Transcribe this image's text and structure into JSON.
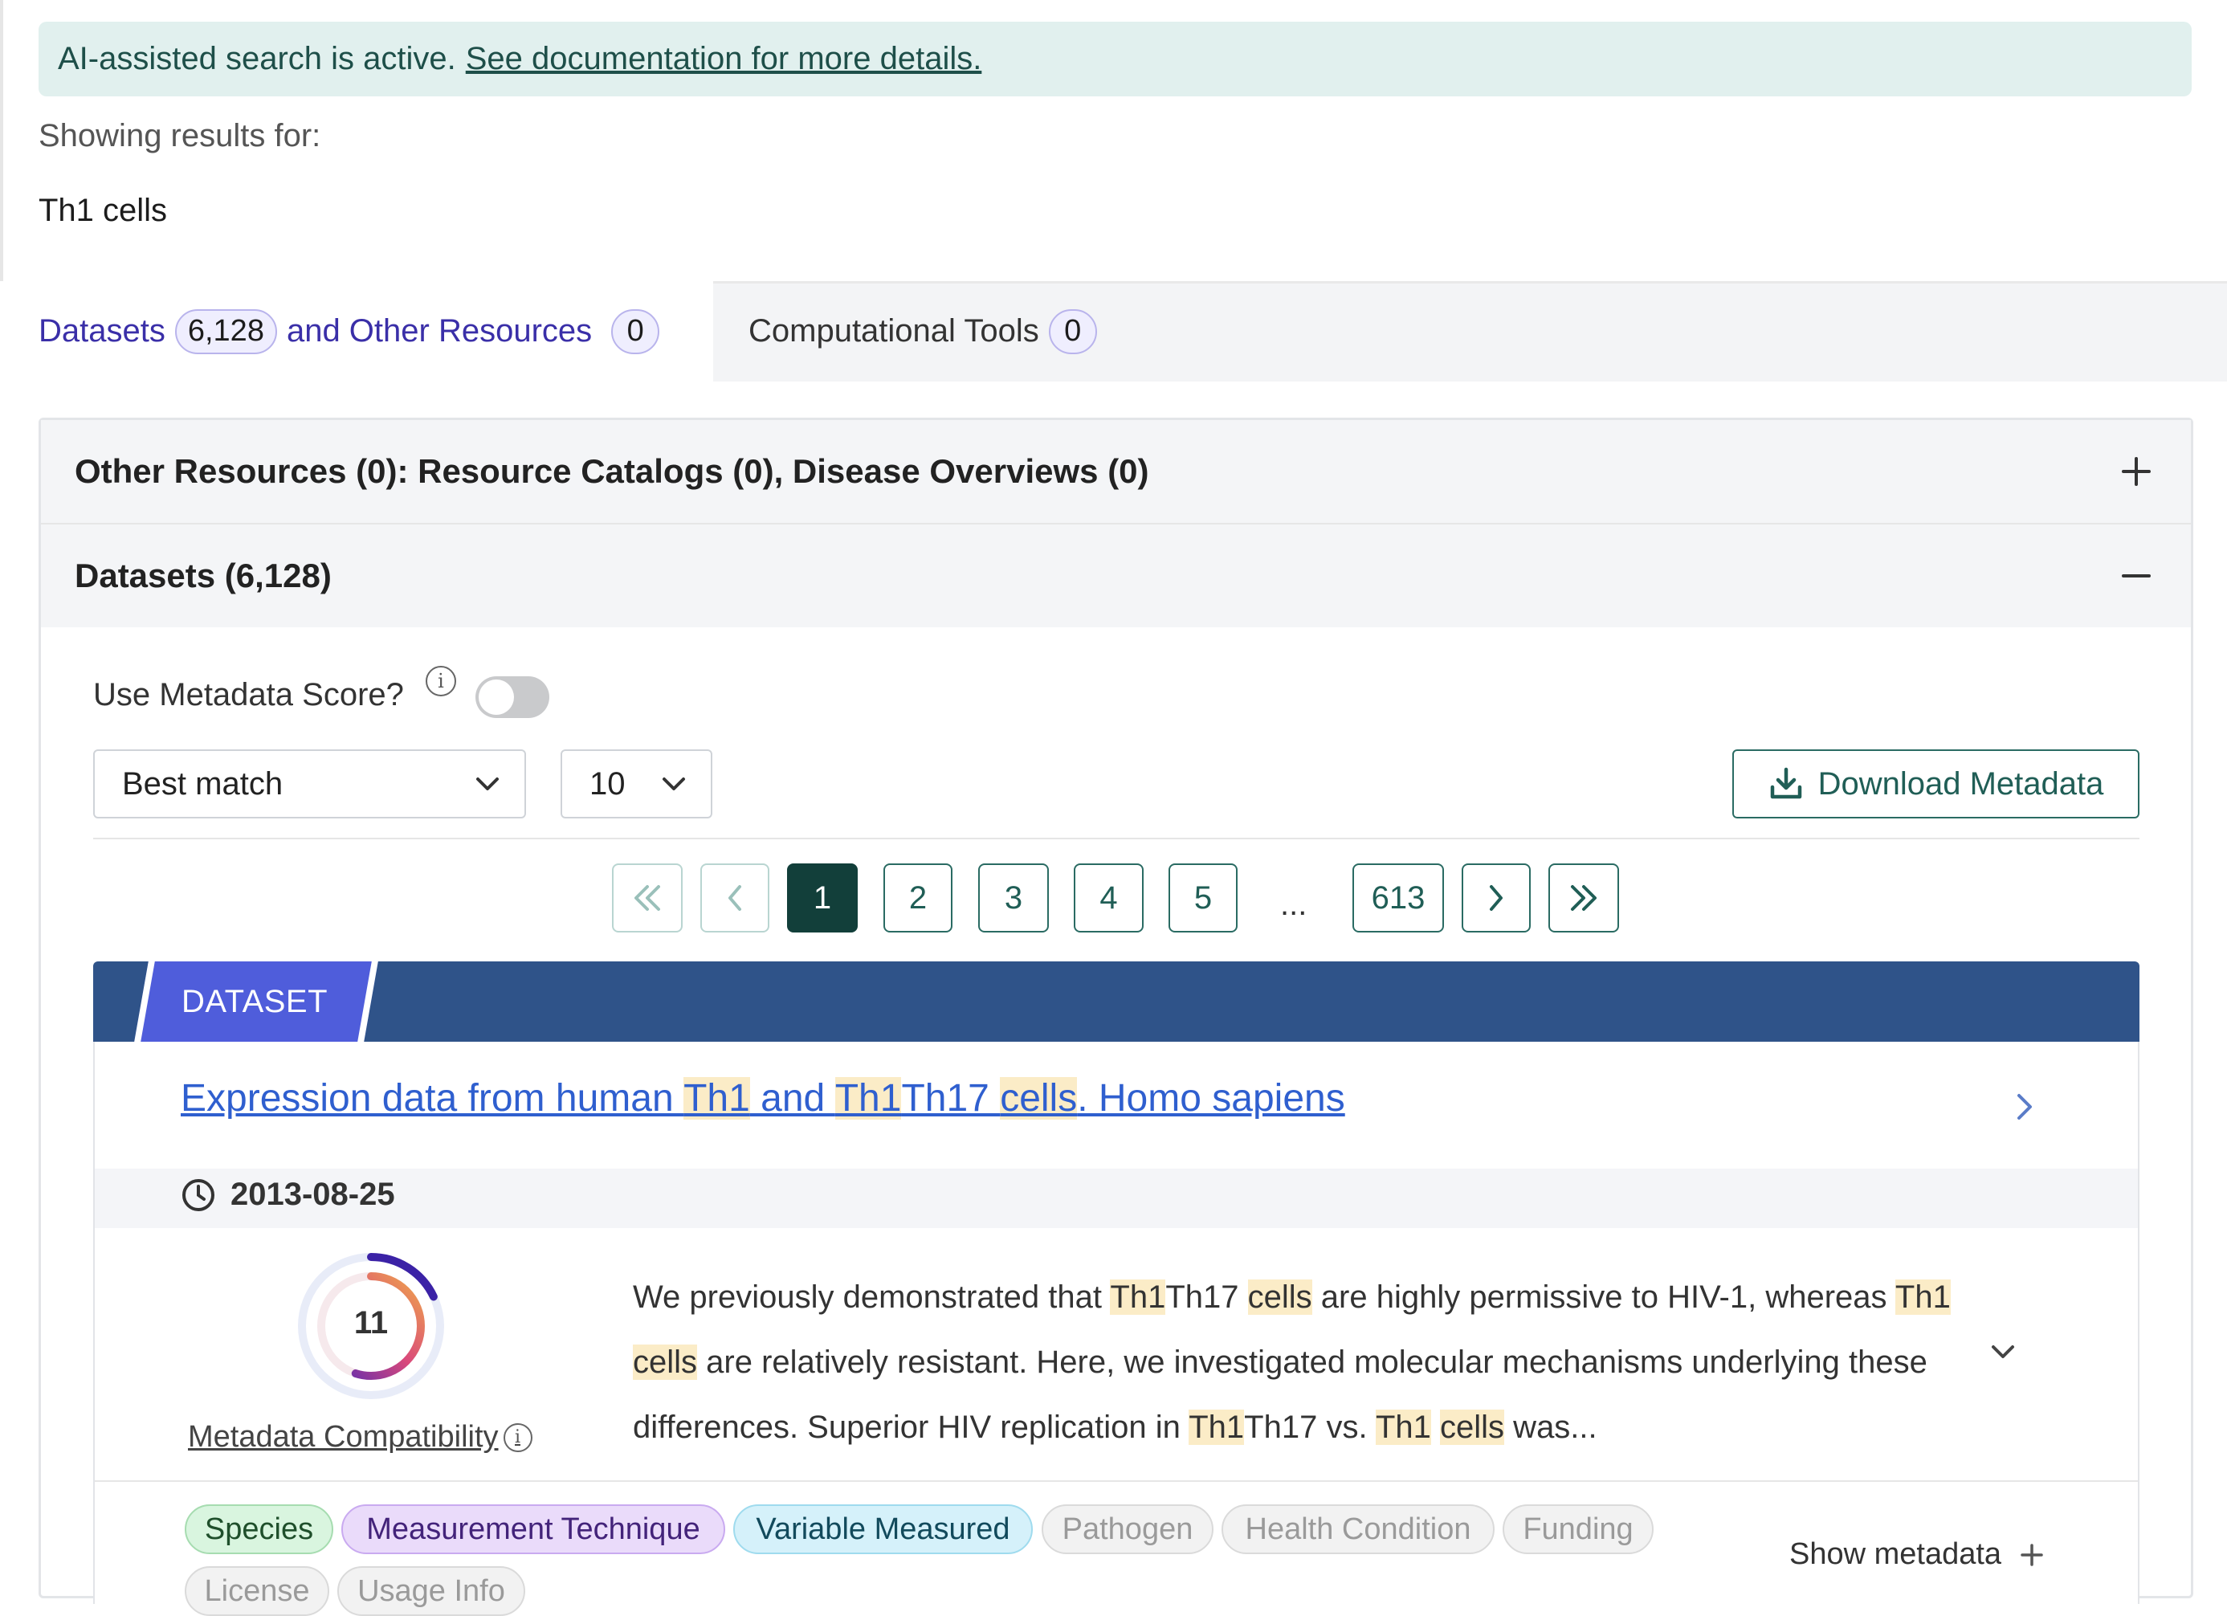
{
  "banner": {
    "text": "AI-assisted search is active.",
    "link": "See documentation for more details."
  },
  "results": {
    "label": "Showing results for:",
    "query": "Th1 cells"
  },
  "tabs": [
    {
      "part1": "Datasets",
      "count1": "6,128",
      "part2": "and Other Resources",
      "count2": "0"
    },
    {
      "label": "Computational Tools",
      "count": "0"
    }
  ],
  "accordion": {
    "other": "Other Resources (0): Resource Catalogs (0), Disease Overviews (0)",
    "datasets": "Datasets (6,128)"
  },
  "controls": {
    "metadata_score_label": "Use Metadata Score?",
    "info_icon": "i",
    "sort_value": "Best match",
    "page_size_value": "10",
    "download_label": "Download Metadata"
  },
  "pagination": {
    "pages": [
      "1",
      "2",
      "3",
      "4",
      "5"
    ],
    "ellipsis": "...",
    "last": "613",
    "current": "1"
  },
  "result": {
    "type_label": "DATASET",
    "title_parts": [
      "Expression data from human ",
      "Th1",
      " and ",
      "Th1",
      "Th17 ",
      "cells",
      ". Homo sapiens"
    ],
    "date": "2013-08-25",
    "score": "11",
    "score_fraction": 0.55,
    "compat_label": "Metadata Compatibility",
    "desc_parts": [
      "We previously demonstrated that ",
      "Th1",
      "Th17 ",
      "cells",
      " are highly permissive to HIV-1, whereas ",
      "Th1",
      " ",
      "cells",
      " are relatively resistant. Here, we investigated molecular mechanisms underlying these differences. Superior HIV replication in ",
      "Th1",
      "Th17 vs. ",
      "Th1",
      " ",
      "cells",
      " was..."
    ],
    "chips": [
      "Species",
      "Measurement Technique",
      "Variable Measured",
      "Pathogen",
      "Health Condition",
      "Funding",
      "License",
      "Usage Info"
    ],
    "show_metadata": "Show metadata"
  },
  "colors": {
    "accent": "#2a6b63",
    "link": "#2f5fcf",
    "highlight": "#fbecc7",
    "typebar": "#2f5389",
    "tag": "#4f5ddb"
  }
}
